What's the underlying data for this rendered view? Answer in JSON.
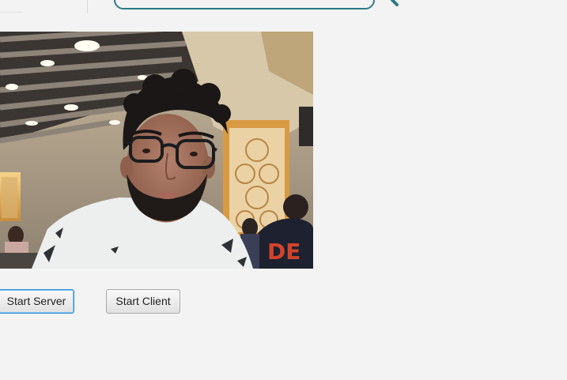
{
  "camera": {
    "alt": "webcam preview",
    "shirt_text": "DE"
  },
  "buttons": {
    "start_server": "Start Server",
    "start_client": "Start Client"
  },
  "colors": {
    "search_border": "#2c7a86",
    "focus_border": "#2f8fd8"
  }
}
